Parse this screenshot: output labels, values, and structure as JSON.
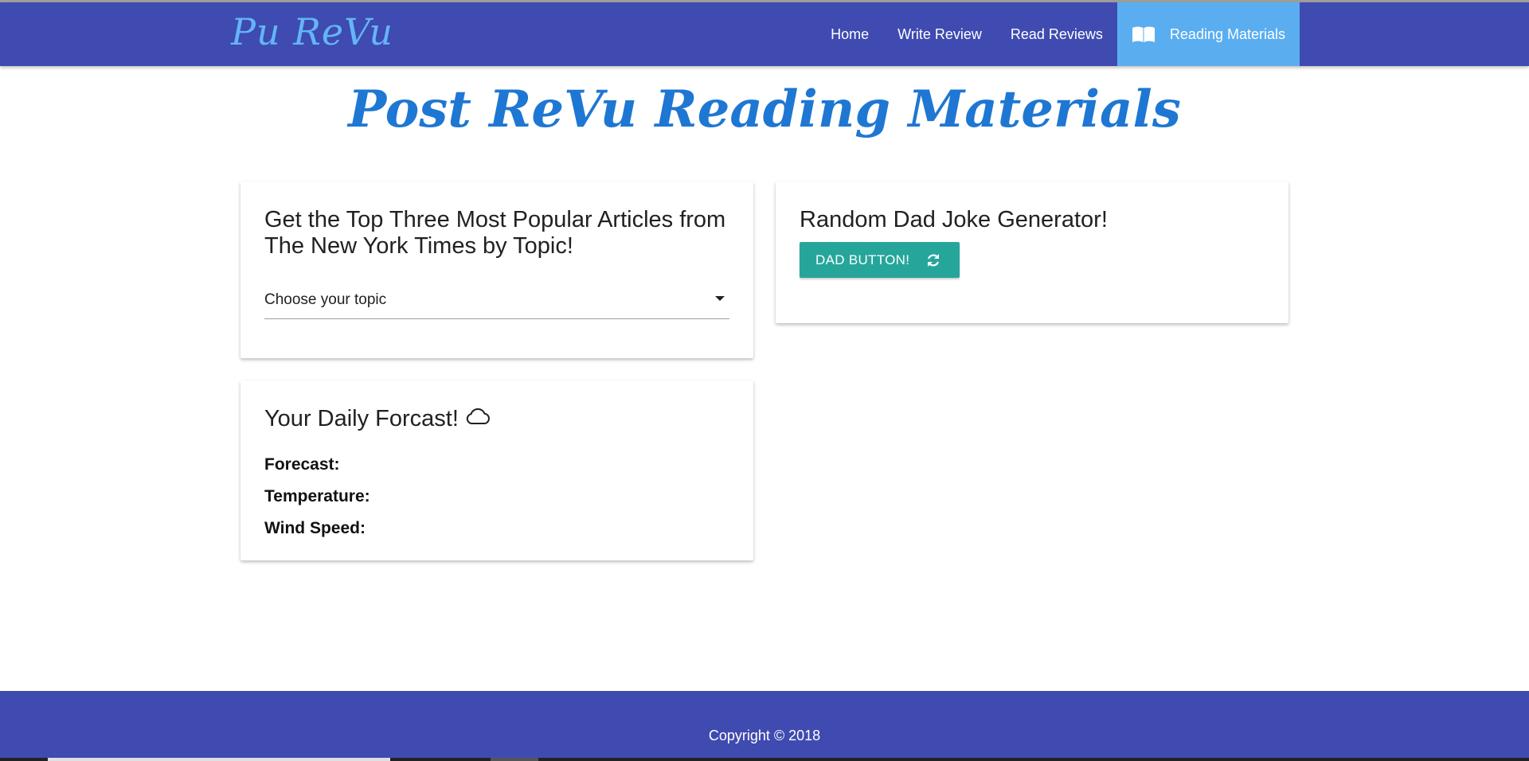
{
  "navbar": {
    "brand": "Pu ReVu",
    "items": [
      {
        "label": "Home"
      },
      {
        "label": "Write Review"
      },
      {
        "label": "Read Reviews"
      },
      {
        "label": "Reading Materials",
        "icon": "book-icon",
        "active": true
      }
    ]
  },
  "page": {
    "title": "Post ReVu Reading Materials"
  },
  "nyt_card": {
    "title": "Get the Top Three Most Popular Articles from The New York Times by Topic!",
    "select": {
      "selected": "Choose your topic"
    }
  },
  "joke_card": {
    "title": "Random Dad Joke Generator!",
    "button_label": "DAD BUTTON!",
    "button_icon": "refresh-icon"
  },
  "weather_card": {
    "title": "Your Daily Forcast!",
    "title_icon": "cloud-icon",
    "fields": {
      "forecast": "Forecast:",
      "temperature": "Temperature:",
      "wind_speed": "Wind Speed:"
    }
  },
  "footer": {
    "copyright": "Copyright © 2018"
  },
  "colors": {
    "navbar": "#3f4bb0",
    "active_nav": "#5aaef0",
    "brand": "#64b5f6",
    "title": "#1e77d2",
    "button": "#26a69a"
  }
}
